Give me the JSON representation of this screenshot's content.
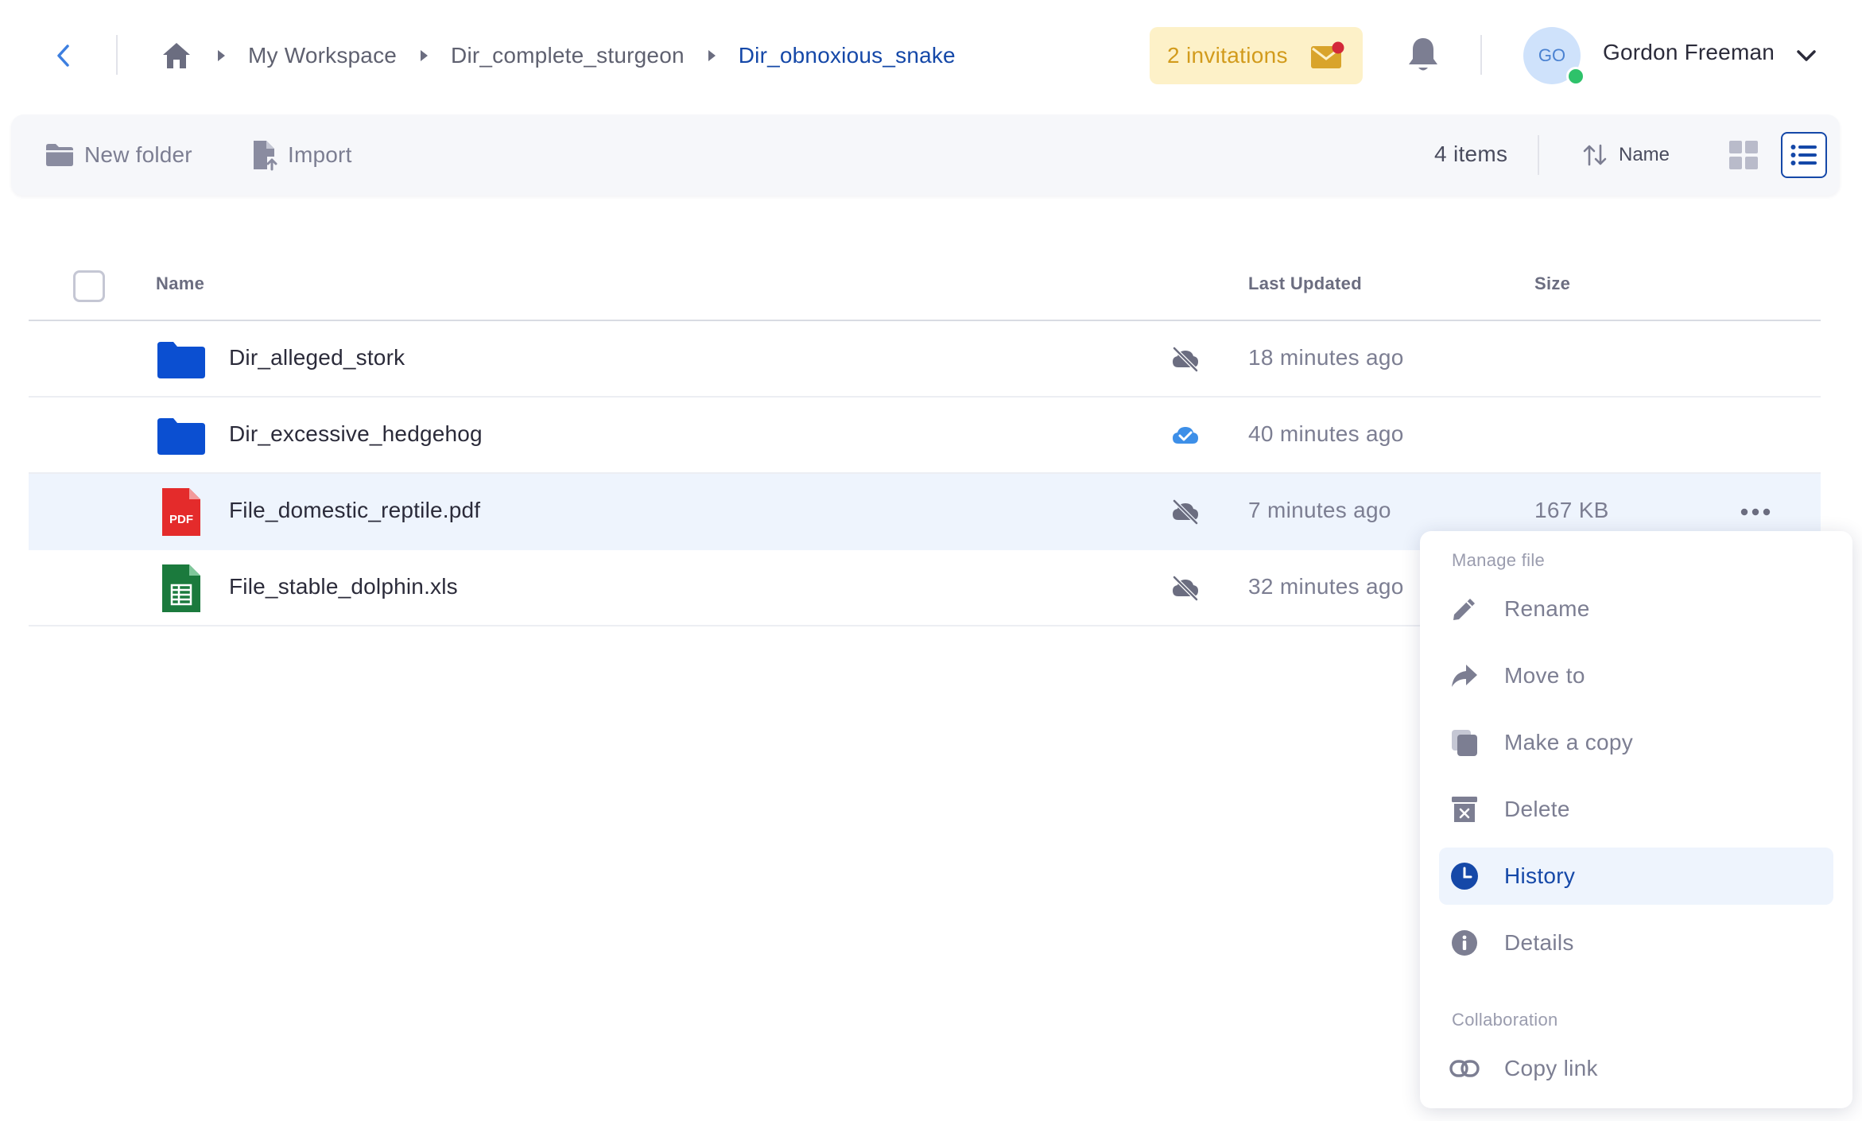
{
  "header": {
    "breadcrumb": [
      "My Workspace",
      "Dir_complete_sturgeon",
      "Dir_obnoxious_snake"
    ],
    "invitations_label": "2 invitations",
    "user": {
      "initials": "GO",
      "name": "Gordon Freeman"
    }
  },
  "toolbar": {
    "new_folder_label": "New folder",
    "import_label": "Import",
    "item_count": "4 items",
    "sort_label": "Name"
  },
  "table": {
    "columns": {
      "name": "Name",
      "updated": "Last Updated",
      "size": "Size"
    },
    "rows": [
      {
        "type": "folder",
        "name": "Dir_alleged_stork",
        "sync": "cloud-off-icon",
        "updated": "18 minutes ago",
        "size": ""
      },
      {
        "type": "folder",
        "name": "Dir_excessive_hedgehog",
        "sync": "cloud-check-icon",
        "updated": "40 minutes ago",
        "size": ""
      },
      {
        "type": "pdf",
        "icon_text": "PDF",
        "name": "File_domestic_reptile.pdf",
        "sync": "cloud-off-icon",
        "updated": "7 minutes ago",
        "size": "167 KB"
      },
      {
        "type": "sheet",
        "name": "File_stable_dolphin.xls",
        "sync": "cloud-off-icon",
        "updated": "32 minutes ago",
        "size": ""
      }
    ]
  },
  "menu": {
    "section_manage": "Manage file",
    "items": [
      "Rename",
      "Move to",
      "Make a copy",
      "Delete",
      "History",
      "Details"
    ],
    "section_collab": "Collaboration",
    "collab_items": [
      "Copy link"
    ]
  },
  "colors": {
    "accent": "#1548a8",
    "folder": "#0b4fd1",
    "pdf": "#e42b2b",
    "sheet": "#1b7a3d",
    "invitation_bg": "#fdf1c8",
    "invitation_text": "#d29b1c",
    "presence": "#2ec26a"
  }
}
